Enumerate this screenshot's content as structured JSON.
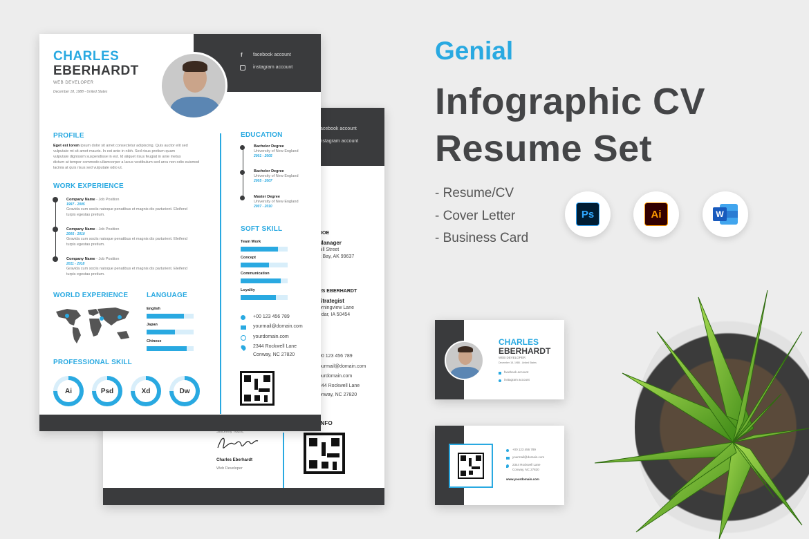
{
  "brand": "Genial",
  "title_line1": "Infographic CV",
  "title_line2": "Resume Set",
  "features": [
    "- Resume/CV",
    "- Cover Letter",
    "- Business Card"
  ],
  "app_icons": [
    {
      "label": "Ps",
      "name": "photoshop-icon",
      "bg": "#001d34",
      "fg": "#31a8ff"
    },
    {
      "label": "Ai",
      "name": "illustrator-icon",
      "bg": "#330000",
      "fg": "#ff9a00"
    },
    {
      "label": "W",
      "name": "word-icon",
      "bg": "#185abd",
      "fg": "#ffffff"
    }
  ],
  "resume": {
    "first_name": "CHARLES",
    "last_name": "EBERHARDT",
    "role": "WEB DEVELOPER",
    "birth": "December 18, 1988 - United States",
    "social": [
      "facebook account",
      "instagram account"
    ],
    "profile_title": "PROFILE",
    "profile_lead": "Eget est lorem",
    "profile_text": [
      "ipsum dolor sit amet consectetur adipiscing. Quis auctor elit sed",
      "vulputate mi sit amet mauris. In est ante in nibh. Sed risus pretium quam",
      "vulputate dignissim suspendisse in est. Id aliquet risus feugiat in ante metus",
      "dictum at tempor commodo ullamcorper a lacus vestibulum sed arcu non odio euismod",
      "lacinia at quis risus sed vulputate odio ut."
    ],
    "work_title": "WORK EXPERIENCE",
    "work": [
      {
        "company": "Company Name",
        "position": " - Job Position",
        "years": "1997 - 2005",
        "line1": "Gravida cum sociis natoque penatibus et magnis dis parturient. Eleifend",
        "line2": "turpis egestas pretium."
      },
      {
        "company": "Company Name",
        "position": " - Job Position",
        "years": "2005 - 2010",
        "line1": "Gravida cum sociis natoque penatibus et magnis dis parturient. Eleifend",
        "line2": "turpis egestas pretium."
      },
      {
        "company": "Company Name",
        "position": " - Job Position",
        "years": "2011 - 2018",
        "line1": "Gravida cum sociis natoque penatibus et magnis dis parturient. Eleifend",
        "line2": "turpis egestas pretium."
      }
    ],
    "world_title": "WORLD EXPERIENCE",
    "language_title": "LANGUAGE",
    "languages": [
      {
        "name": "English",
        "level": 0.8
      },
      {
        "name": "Japan",
        "level": 0.6
      },
      {
        "name": "Chinese",
        "level": 0.85
      }
    ],
    "pro_skill_title": "PROFESSIONAL SKILL",
    "pro_skills": [
      "Ai",
      "Psd",
      "Xd",
      "Dw"
    ],
    "education_title": "EDUCATION",
    "education": [
      {
        "degree": "Bachelor Degree",
        "school": "University of New England",
        "years": "2001 - 2005"
      },
      {
        "degree": "Bachelor Degree",
        "school": "University of New England",
        "years": "2005 - 2007"
      },
      {
        "degree": "Master Degree",
        "school": "University of New England",
        "years": "2007 - 2010"
      }
    ],
    "soft_skill_title": "SOFT SKILL",
    "soft_skills": [
      {
        "name": "Team Work",
        "level": 0.8
      },
      {
        "name": "Concept",
        "level": 0.6
      },
      {
        "name": "Communication",
        "level": 0.85
      },
      {
        "name": "Loyality",
        "level": 0.75
      }
    ],
    "contact": [
      "+00 123 456 789",
      "yourmail@domain.com",
      "yourdomain.com",
      "2344 Rockwell Lane",
      "Conway, NC 27820"
    ]
  },
  "cover": {
    "social": [
      "facebook account",
      "instagram account"
    ],
    "frag1": [
      "DOE",
      "Manager",
      "hill Street",
      "k Bay, AK 99637"
    ],
    "frag2": [
      "ES EBERHARDT",
      "Strategist",
      "orningview Lane",
      "edar, IA 50454"
    ],
    "frag_contact": [
      "00 123 456 789",
      "ourmail@domain.com",
      "ourdomain.com",
      "344 Rockwell Lane",
      "onway, NC 27820"
    ],
    "info": "INFO",
    "sincerely": "Sincerely Yours,",
    "signature": "Charles Eberhardt",
    "sig_role": "Web Developer"
  },
  "card1": {
    "first_name": "CHARLES",
    "last_name": "EBERHARDT",
    "role": "WEB DEVELOPER",
    "birth": "December 18, 1988 - United States",
    "social": [
      "facebook account",
      "instagram account"
    ]
  },
  "card2": {
    "contact": [
      "+00 123 456 789",
      "yourmail@domain.com",
      "2344 Rockwell Lane",
      "Conway, NC 27820"
    ],
    "site": "www.yourdomain.com"
  },
  "colors": {
    "accent": "#29a9e1",
    "dark": "#3a3b3d",
    "title": "#444547"
  }
}
